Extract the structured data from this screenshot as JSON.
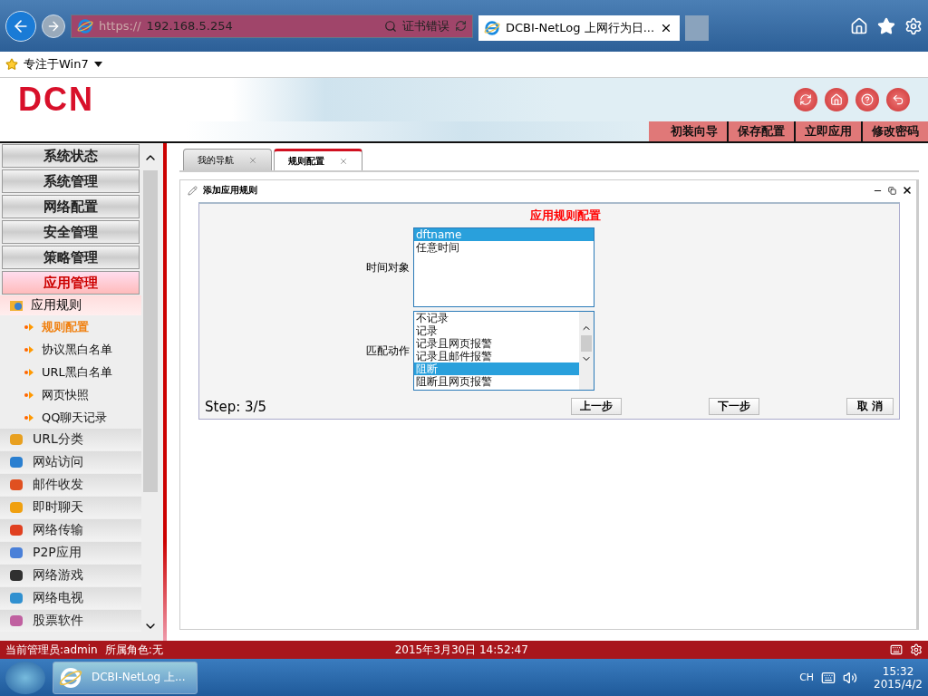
{
  "browser": {
    "url_scheme": "https://",
    "url_host": "192.168.5.254",
    "cert_error": "证书错误",
    "tabs": [
      {
        "title": "DCBI-NetLog 上网行为日...",
        "selected": true
      }
    ],
    "favorites": [
      {
        "label": "专注于Win7"
      }
    ]
  },
  "header": {
    "logo": "DCN",
    "links": [
      "初装向导",
      "保存配置",
      "立即应用",
      "修改密码"
    ]
  },
  "sidebar": {
    "menus": [
      {
        "label": "系统状态",
        "selected": false
      },
      {
        "label": "系统管理",
        "selected": false
      },
      {
        "label": "网络配置",
        "selected": false
      },
      {
        "label": "安全管理",
        "selected": false
      },
      {
        "label": "策略管理",
        "selected": false
      },
      {
        "label": "应用管理",
        "selected": true
      }
    ],
    "group": {
      "label": "应用规则",
      "children": [
        {
          "label": "规则配置",
          "selected": true
        },
        {
          "label": "协议黑白名单",
          "selected": false
        },
        {
          "label": "URL黑白名单",
          "selected": false
        },
        {
          "label": "网页快照",
          "selected": false
        },
        {
          "label": "QQ聊天记录",
          "selected": false
        }
      ]
    },
    "categories": [
      {
        "label": "URL分类",
        "color": "#e8a020"
      },
      {
        "label": "网站访问",
        "color": "#2a7fd0"
      },
      {
        "label": "邮件收发",
        "color": "#e05020"
      },
      {
        "label": "即时聊天",
        "color": "#f0a010"
      },
      {
        "label": "网络传输",
        "color": "#e04020"
      },
      {
        "label": "P2P应用",
        "color": "#4a80d8"
      },
      {
        "label": "网络游戏",
        "color": "#303030"
      },
      {
        "label": "网络电视",
        "color": "#3090d0"
      },
      {
        "label": "股票软件",
        "color": "#c060a0"
      }
    ]
  },
  "tabs": [
    {
      "label": "我的导航",
      "selected": false
    },
    {
      "label": "规则配置",
      "selected": true
    }
  ],
  "panel": {
    "title": "添加应用规则",
    "form": {
      "heading": "应用规则配置",
      "fields": [
        {
          "label": "时间对象",
          "scrollable": false,
          "options": [
            {
              "label": "dftname",
              "selected": true
            },
            {
              "label": "任意时间",
              "selected": false
            }
          ]
        },
        {
          "label": "匹配动作",
          "scrollable": true,
          "options": [
            {
              "label": "不记录",
              "selected": false
            },
            {
              "label": "记录",
              "selected": false
            },
            {
              "label": "记录且网页报警",
              "selected": false
            },
            {
              "label": "记录且邮件报警",
              "selected": false
            },
            {
              "label": "阻断",
              "selected": true
            },
            {
              "label": "阻断且网页报警",
              "selected": false
            }
          ]
        }
      ],
      "step": "Step: 3/5",
      "buttons": [
        "上一步",
        "下一步",
        "取 消"
      ]
    }
  },
  "status_bar": {
    "admin": "当前管理员:admin",
    "role": "所属角色:无",
    "datetime": "2015年3月30日 14:52:47"
  },
  "taskbar": {
    "task": "DCBI-NetLog 上...",
    "lang": "CH",
    "time": "15:32",
    "date": "2015/4/2"
  }
}
